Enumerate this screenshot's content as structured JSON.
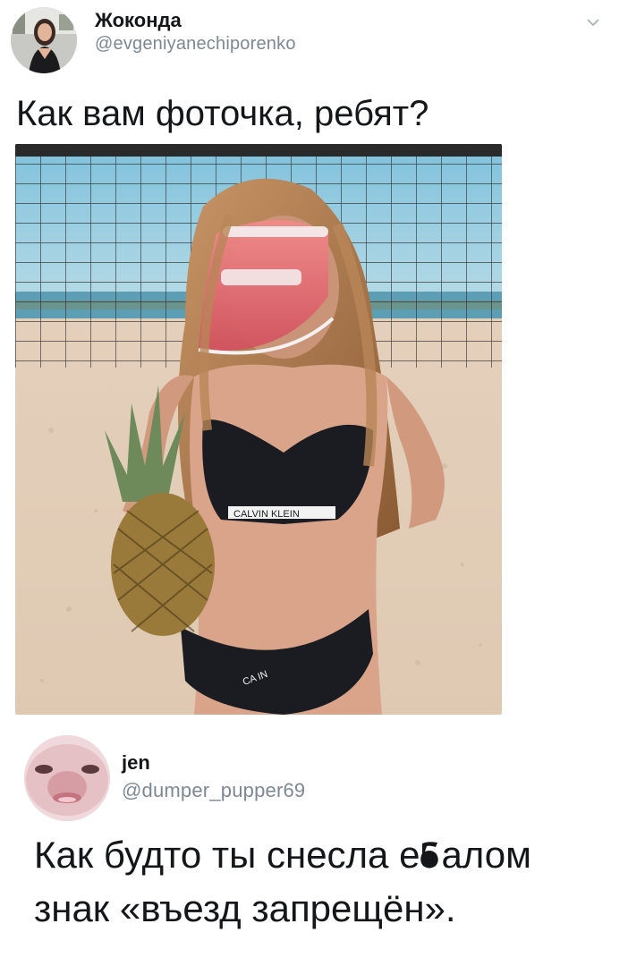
{
  "tweet": {
    "author_name": "Жоконда",
    "author_handle": "@evgeniyanechiporenko",
    "text": "Как вам фоточка, ребят?",
    "chevron_icon": "chevron-down-icon",
    "photo_brand_top": "CALVIN KLEIN",
    "photo_brand_bottom": "CA IN"
  },
  "reply": {
    "author_name": "jen",
    "author_handle": "@dumper_pupper69",
    "text_line1": "Как будто ты снесла е",
    "text_line1_b": "алом",
    "text_line2": "знак «въезд запрещён»."
  },
  "colors": {
    "text": "#14171a",
    "handle": "#7d8893",
    "sky": "#8fc9e0",
    "sand": "#e6d6c4",
    "bikini": "#1a1c22",
    "visor": "#e0707a"
  }
}
